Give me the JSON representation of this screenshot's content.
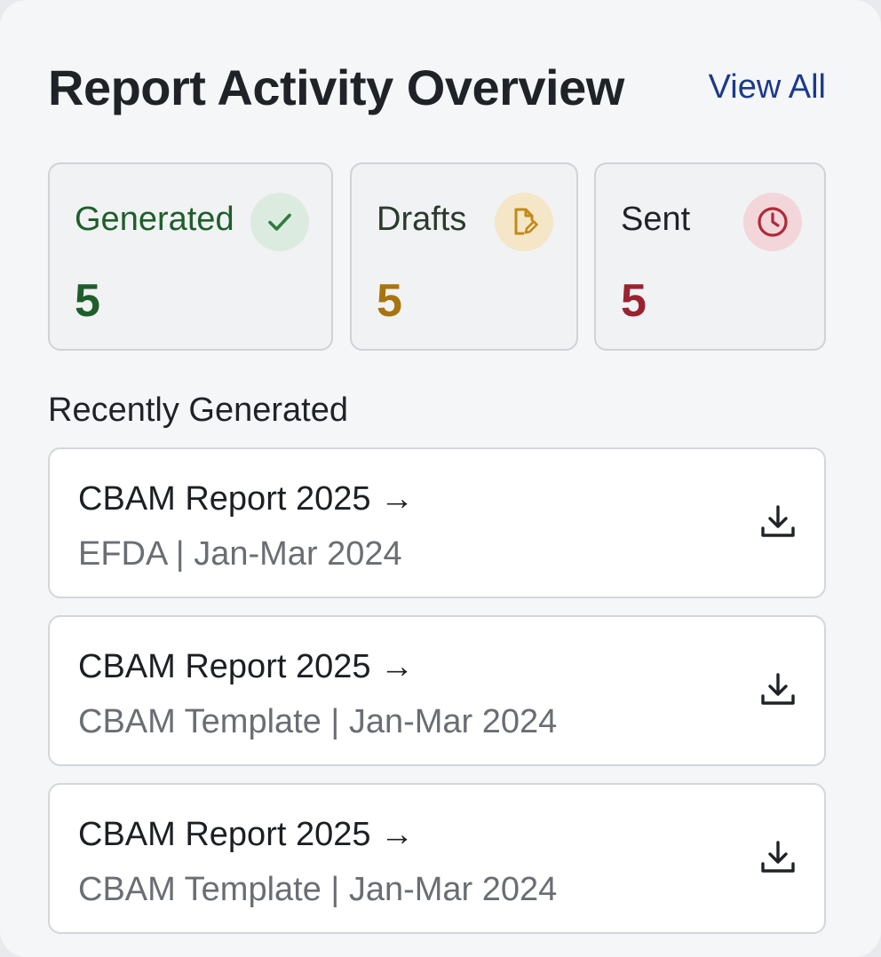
{
  "header": {
    "title": "Report Activity Overview",
    "view_all_label": "View All"
  },
  "stats": [
    {
      "label": "Generated",
      "value": "5",
      "icon": "check-icon",
      "color": "#1e5e2a",
      "icon_bg": "#dcebdf"
    },
    {
      "label": "Drafts",
      "value": "5",
      "icon": "edit-document-icon",
      "color": "#a8740e",
      "icon_bg": "#f5e6c8"
    },
    {
      "label": "Sent",
      "value": "5",
      "icon": "clock-icon",
      "color": "#9b2230",
      "icon_bg": "#f2d6da"
    }
  ],
  "recent": {
    "section_label": "Recently Generated",
    "items": [
      {
        "title": "CBAM Report 2025 →",
        "subtitle": "EFDA | Jan-Mar 2024",
        "icon": "download-icon"
      },
      {
        "title": "CBAM Report 2025 →",
        "subtitle": "CBAM Template | Jan-Mar 2024",
        "icon": "download-icon"
      },
      {
        "title": "CBAM Report 2025 →",
        "subtitle": "CBAM Template | Jan-Mar 2024",
        "icon": "download-icon"
      }
    ]
  },
  "colors": {
    "view_all": "#1c3a8a",
    "title": "#1f2328",
    "subtitle": "#6a6e74"
  }
}
